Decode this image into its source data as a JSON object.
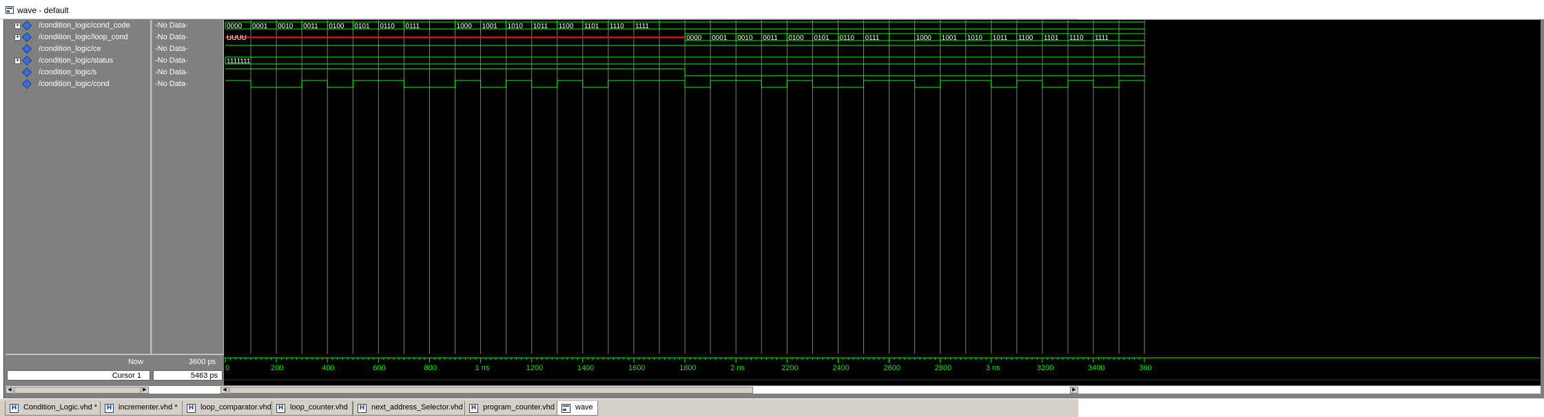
{
  "window": {
    "title": "wave - default"
  },
  "signals": [
    {
      "name": "/condition_logic/cond_code",
      "value": "-No Data-",
      "expandable": true,
      "expand_glyph": "+"
    },
    {
      "name": "/condition_logic/loop_cond",
      "value": "-No Data-",
      "expandable": true,
      "expand_glyph": "+"
    },
    {
      "name": "/condition_logic/ce",
      "value": "-No Data-",
      "expandable": false
    },
    {
      "name": "/condition_logic/status",
      "value": "-No Data-",
      "expandable": true,
      "expand_glyph": "+"
    },
    {
      "name": "/condition_logic/s",
      "value": "-No Data-",
      "expandable": false
    },
    {
      "name": "/condition_logic/cond",
      "value": "-No Data-",
      "expandable": false
    }
  ],
  "cursor_pane": {
    "now_label": "Now",
    "now_value": "3600 ps",
    "cursor_label": "Cursor 1",
    "cursor_value": "5463 ps"
  },
  "waveforms": {
    "time_range_ps": [
      0,
      3600
    ],
    "cond_code_values": [
      "0000",
      "0001",
      "0010",
      "0011",
      "0100",
      "0101",
      "0110",
      "0111",
      "",
      "1000",
      "1001",
      "1010",
      "1011",
      "1100",
      "1101",
      "1110",
      "1111"
    ],
    "loop_cond_initial": "UUUU",
    "loop_cond_values": [
      "0000",
      "0001",
      "0010",
      "0011",
      "0100",
      "0101",
      "0110",
      "0111",
      "",
      "1000",
      "1001",
      "1010",
      "1011",
      "1100",
      "1101",
      "1110",
      "1111"
    ],
    "status_value": "1111111",
    "colors": {
      "bus": "#00ff00",
      "undefined": "#ff0000",
      "grid": "#808080",
      "background": "#000000"
    }
  },
  "timeline": {
    "tick_labels": [
      "0",
      "200",
      "400",
      "600",
      "800",
      "1 ns",
      "1200",
      "1400",
      "1600",
      "1800",
      "2 ns",
      "2200",
      "2400",
      "2600",
      "2800",
      "3 ns",
      "3200",
      "3400",
      "360"
    ]
  },
  "tabs": [
    {
      "label": "Condition_Logic.vhd *",
      "icon": "vhdl-file-icon",
      "glyph": "H",
      "active": false
    },
    {
      "label": "incrementer.vhd *",
      "icon": "vhdl-file-icon",
      "glyph": "H",
      "active": false
    },
    {
      "label": "loop_comparator.vhd",
      "icon": "vhdl-file-icon",
      "glyph": "H",
      "active": false
    },
    {
      "label": "loop_counter.vhd",
      "icon": "vhdl-file-icon",
      "glyph": "H",
      "active": false
    },
    {
      "label": "next_address_Selector.vhd",
      "icon": "vhdl-file-icon",
      "glyph": "H",
      "active": false
    },
    {
      "label": "program_counter.vhd",
      "icon": "vhdl-file-icon",
      "glyph": "H",
      "active": false
    },
    {
      "label": "wave",
      "icon": "wave-window-icon",
      "glyph": "",
      "active": true
    }
  ]
}
